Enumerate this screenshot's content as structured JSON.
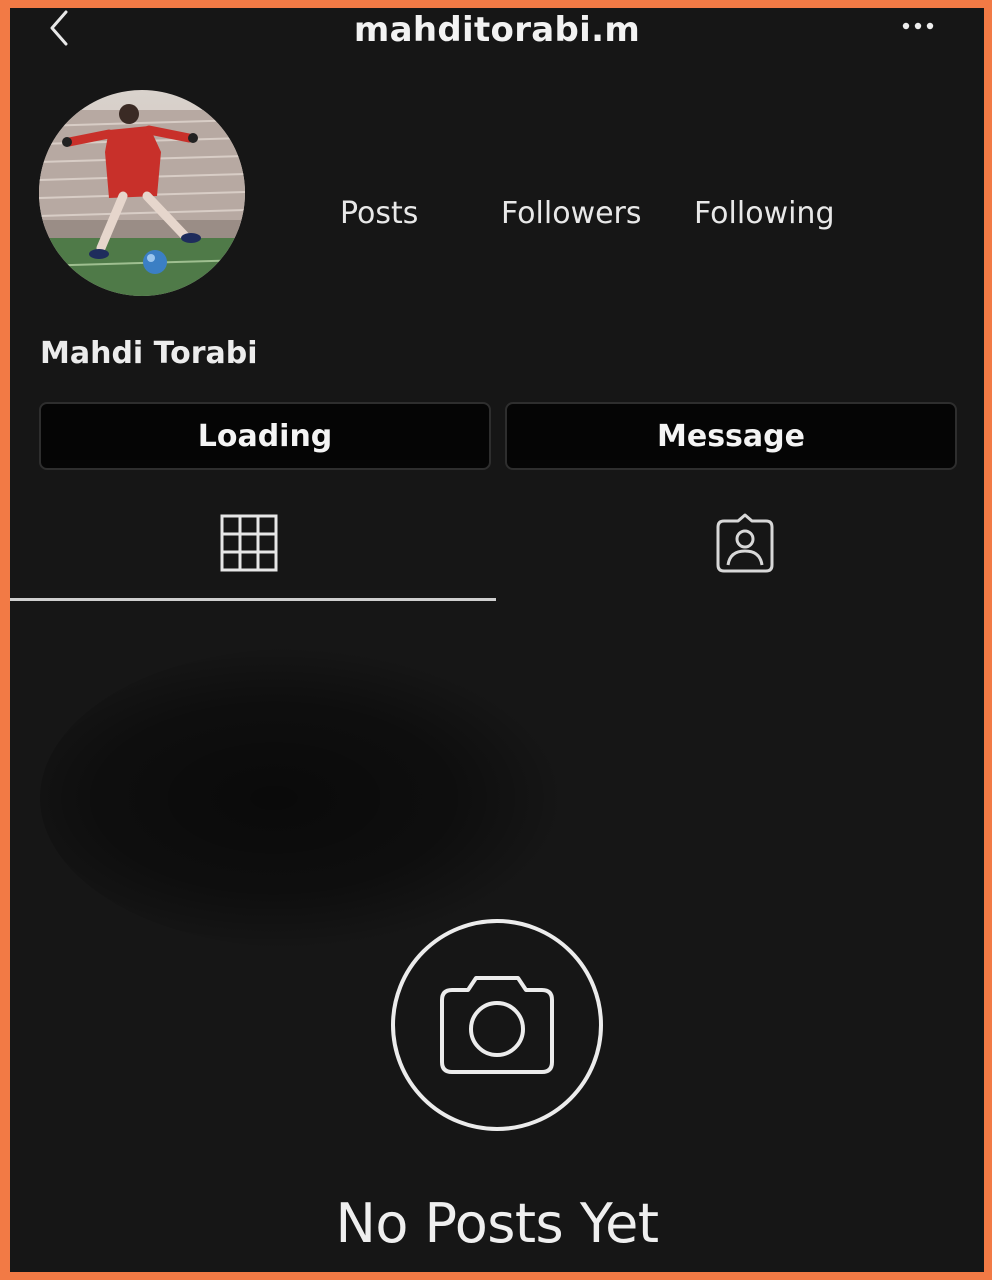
{
  "header": {
    "username": "mahditorabi.m",
    "back_icon": "chevron-left-icon",
    "more_icon": "more-horizontal-icon"
  },
  "profile": {
    "full_name": "Mahdi Torabi",
    "avatar": "profile-photo-soccer-player"
  },
  "stats": {
    "posts_label": "Posts",
    "followers_label": "Followers",
    "following_label": "Following"
  },
  "actions": {
    "primary_label": "Loading",
    "message_label": "Message"
  },
  "tabs": [
    {
      "name": "grid",
      "icon": "grid-icon",
      "active": true
    },
    {
      "name": "tagged",
      "icon": "tagged-person-icon",
      "active": false
    }
  ],
  "empty_state": {
    "icon": "camera-icon",
    "title": "No Posts Yet"
  },
  "colors": {
    "background": "#161616",
    "border_frame": "#f27a45",
    "text": "#f0f0f0",
    "button_bg": "#050505"
  }
}
